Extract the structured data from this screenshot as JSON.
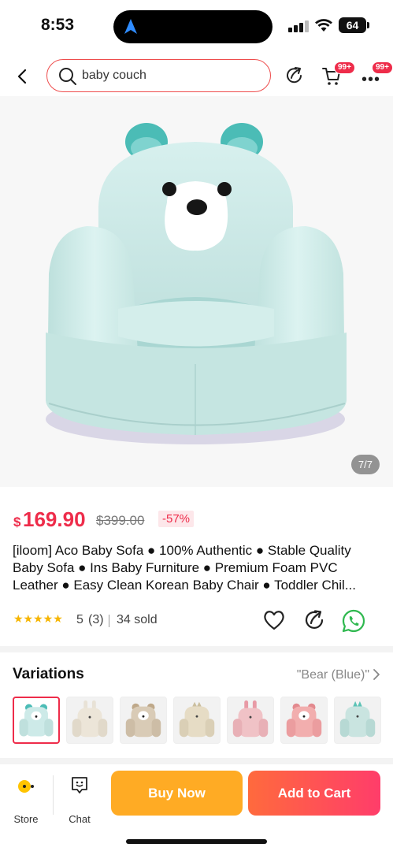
{
  "status_bar": {
    "time": "8:53",
    "battery": "64"
  },
  "nav": {
    "search_value": "baby couch",
    "cart_badge": "99+",
    "more_badge": "99+"
  },
  "gallery": {
    "page_indicator": "7/7"
  },
  "product": {
    "currency": "$",
    "price": "169.90",
    "original_price": "$399.00",
    "discount": "-57%",
    "title": "[iloom] Aco Baby Sofa ● 100% Authentic ● Stable Quality Baby Sofa ● Ins Baby Furniture ● Premium Foam PVC Leather ● Easy Clean Korean Baby Chair ● Toddler Chil...",
    "stars": "★★★★★",
    "rating": "5",
    "review_count": "(3)",
    "sold": "34 sold"
  },
  "variations": {
    "heading": "Variations",
    "selected": "\"Bear (Blue)\"",
    "items": [
      "bear-blue",
      "rabbit-beige",
      "bear-brown",
      "dino-beige",
      "rabbit-pink",
      "bear-pink",
      "dino-mint"
    ]
  },
  "bottom_bar": {
    "store_label": "Store",
    "chat_label": "Chat",
    "buy_now": "Buy Now",
    "add_to_cart": "Add to Cart"
  },
  "colors": {
    "accent": "#ee2c4a",
    "buy_now": "#ffab24",
    "add_to_cart_start": "#ff6a3d",
    "add_to_cart_end": "#ff3d6a",
    "stars": "#f6b500",
    "sofa": "#cdeae8"
  }
}
